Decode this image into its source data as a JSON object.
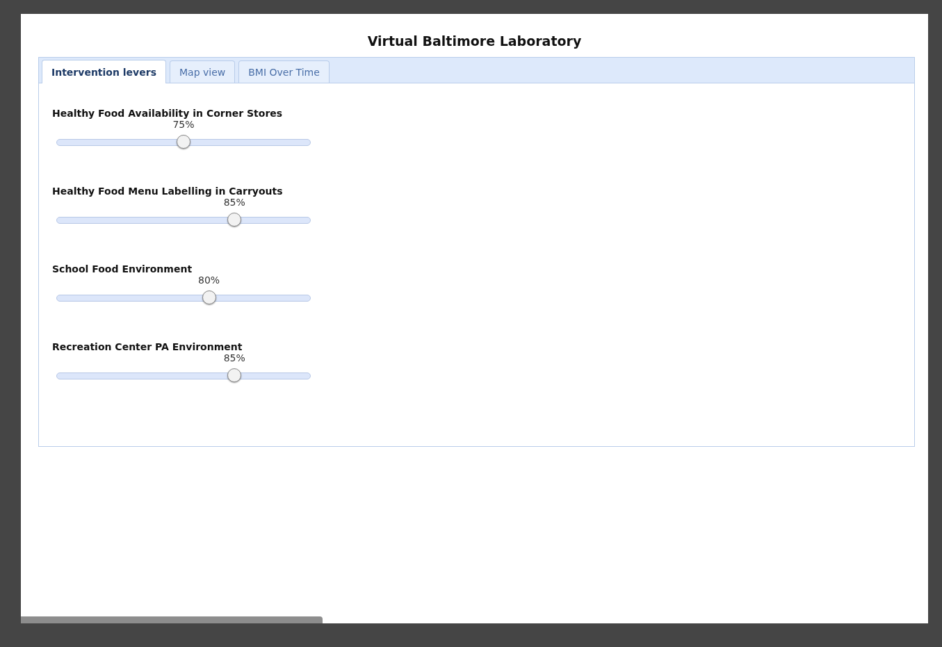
{
  "title": "Virtual Baltimore Laboratory",
  "tabs": [
    {
      "label": "Intervention levers",
      "selected": true
    },
    {
      "label": "Map view",
      "selected": false
    },
    {
      "label": "BMI Over Time",
      "selected": false
    }
  ],
  "sliders": [
    {
      "label": "Healthy Food Availability in Corner Stores",
      "reading": "75%",
      "level": 0.5
    },
    {
      "label": "Healthy Food Menu Labelling in Carryouts",
      "reading": "85%",
      "level": 0.7
    },
    {
      "label": "School Food Environment",
      "reading": "80%",
      "level": 0.6
    },
    {
      "label": "Recreation Center PA Environment",
      "reading": "85%",
      "level": 0.7
    }
  ]
}
